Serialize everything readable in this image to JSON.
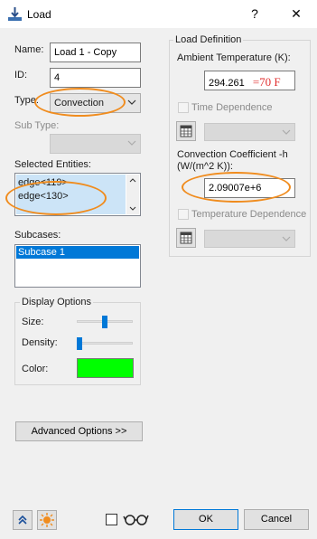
{
  "window": {
    "title": "Load",
    "help_label": "?",
    "close_label": "✕"
  },
  "left": {
    "name_label": "Name:",
    "name_value": "Load 1 - Copy",
    "id_label": "ID:",
    "id_value": "4",
    "type_label": "Type:",
    "type_value": "Convection",
    "subtype_label": "Sub Type:",
    "selected_label": "Selected Entities:",
    "entities": [
      "edge<119>",
      "edge<130>"
    ],
    "subcases_label": "Subcases:",
    "subcases": [
      "Subcase 1"
    ],
    "display_options": {
      "title": "Display Options",
      "size_label": "Size:",
      "size_level": 0.5,
      "density_label": "Density:",
      "density_level": 0.0,
      "color_label": "Color:",
      "color": "#00ff00"
    },
    "advanced_label": "Advanced Options >>"
  },
  "right": {
    "group_title": "Load Definition",
    "ambient_label": "Ambient Temperature (K):",
    "ambient_value": "294.261",
    "ambient_annotation": "=70 F",
    "time_dep_label": "Time Dependence",
    "conv_label_line1": "Convection Coefficient -h",
    "conv_label_line2": "(W/(m^2 K)):",
    "conv_value": "2.09007e+6",
    "temp_dep_label": "Temperature Dependence"
  },
  "footer": {
    "ok_label": "OK",
    "cancel_label": "Cancel"
  },
  "colors": {
    "accent": "#0078d7",
    "highlight_ring": "#f08c1e",
    "annotation": "#e03030",
    "selection": "#0078d7"
  }
}
